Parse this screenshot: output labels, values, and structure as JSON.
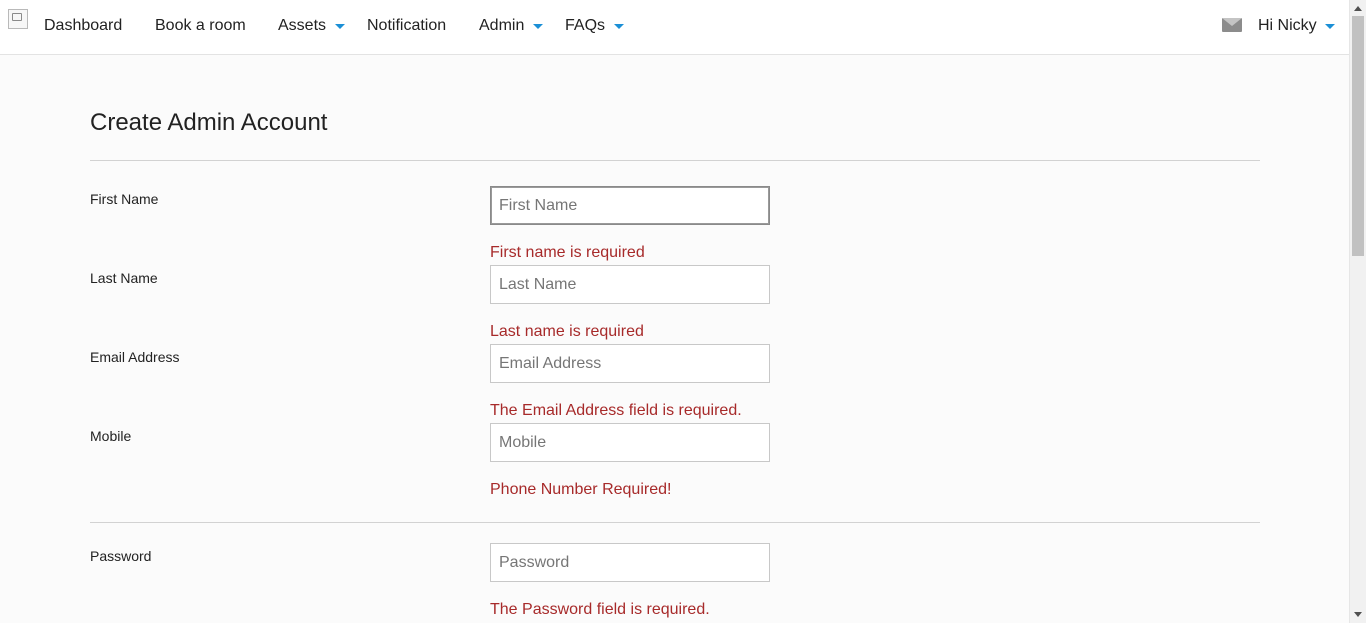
{
  "nav": {
    "items": [
      {
        "label": "Dashboard",
        "has_dropdown": false
      },
      {
        "label": "Book a room",
        "has_dropdown": false
      },
      {
        "label": "Assets",
        "has_dropdown": true
      },
      {
        "label": "Notification",
        "has_dropdown": false
      },
      {
        "label": "Admin",
        "has_dropdown": true
      },
      {
        "label": "FAQs",
        "has_dropdown": true
      }
    ],
    "user_greeting": "Hi Nicky",
    "mail_icon": "envelope-icon",
    "accent_color": "#1b8fd6"
  },
  "form": {
    "title": "Create Admin Account",
    "fields": [
      {
        "label": "First Name",
        "placeholder": "First Name",
        "value": "",
        "error": "First name is required"
      },
      {
        "label": "Last Name",
        "placeholder": "Last Name",
        "value": "",
        "error": "Last name is required"
      },
      {
        "label": "Email Address",
        "placeholder": "Email Address",
        "value": "",
        "error": "The Email Address field is required."
      },
      {
        "label": "Mobile",
        "placeholder": "Mobile",
        "value": "",
        "error": "Phone Number Required!"
      },
      {
        "label": "Password",
        "placeholder": "Password",
        "value": "",
        "error": "The Password field is required."
      }
    ],
    "error_color": "#a72a2a"
  }
}
